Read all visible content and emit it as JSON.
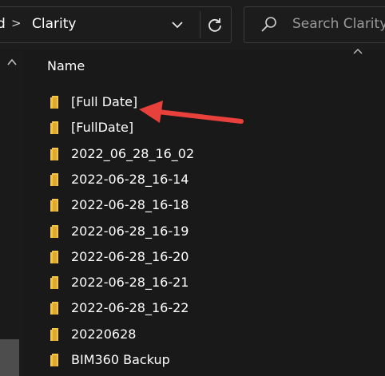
{
  "address": {
    "previous_crumb": "d",
    "separator": ">",
    "current_folder": "Clarity"
  },
  "search": {
    "placeholder": "Search Clarity"
  },
  "list": {
    "column_header": "Name",
    "items": [
      {
        "name": "[Full Date]"
      },
      {
        "name": "[FullDate]"
      },
      {
        "name": "2022_06_28_16_02"
      },
      {
        "name": "2022-06-28_16-14"
      },
      {
        "name": "2022-06-28_16-18"
      },
      {
        "name": "2022-06-28_16-19"
      },
      {
        "name": "2022-06-28_16-20"
      },
      {
        "name": "2022-06-28_16-21"
      },
      {
        "name": "2022-06-28_16-22"
      },
      {
        "name": "20220628"
      },
      {
        "name": "BIM360 Backup"
      }
    ]
  },
  "icons": {
    "folder": "folder-icon",
    "dropdown": "chevron-down-icon",
    "refresh": "refresh-icon",
    "search": "search-icon",
    "sort": "chevron-up-icon",
    "annotation": "red-arrow-annotation"
  },
  "colors": {
    "background": "#191919",
    "folder_yellow": "#f4c542",
    "annotation_red": "#e8403a",
    "text": "#ffffff",
    "placeholder": "#9a9a9a"
  }
}
